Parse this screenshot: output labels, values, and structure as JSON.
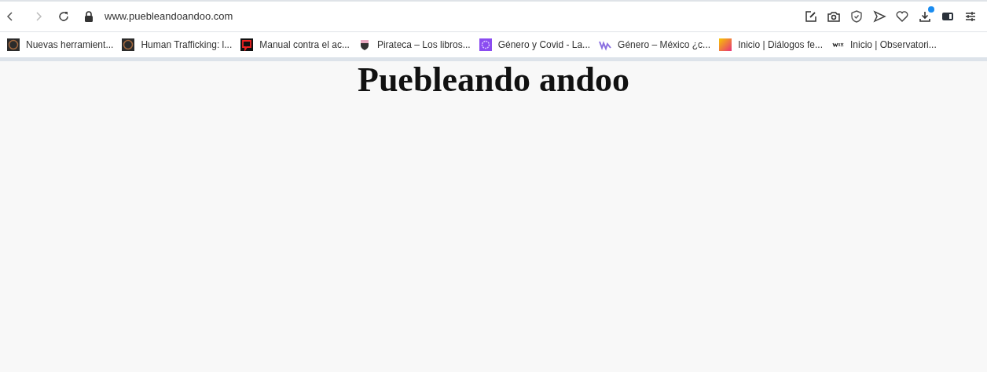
{
  "browser": {
    "address": "www.puebleandoandoo.com",
    "download_badge": true
  },
  "bookmarks": [
    {
      "label": "Nuevas herramient...",
      "kind": "ring"
    },
    {
      "label": "Human Trafficking: l...",
      "kind": "ring"
    },
    {
      "label": "Manual contra el ac...",
      "kind": "speech"
    },
    {
      "label": "Pirateca – Los libros...",
      "kind": "shield"
    },
    {
      "label": "Género y Covid - La...",
      "kind": "gear"
    },
    {
      "label": "Género – México ¿c...",
      "kind": "wave"
    },
    {
      "label": "Inicio | Diálogos fe...",
      "kind": "gradient"
    },
    {
      "label": "Inicio | Observatori...",
      "kind": "wordmark"
    }
  ],
  "page": {
    "title": "Puebleando andoo"
  }
}
